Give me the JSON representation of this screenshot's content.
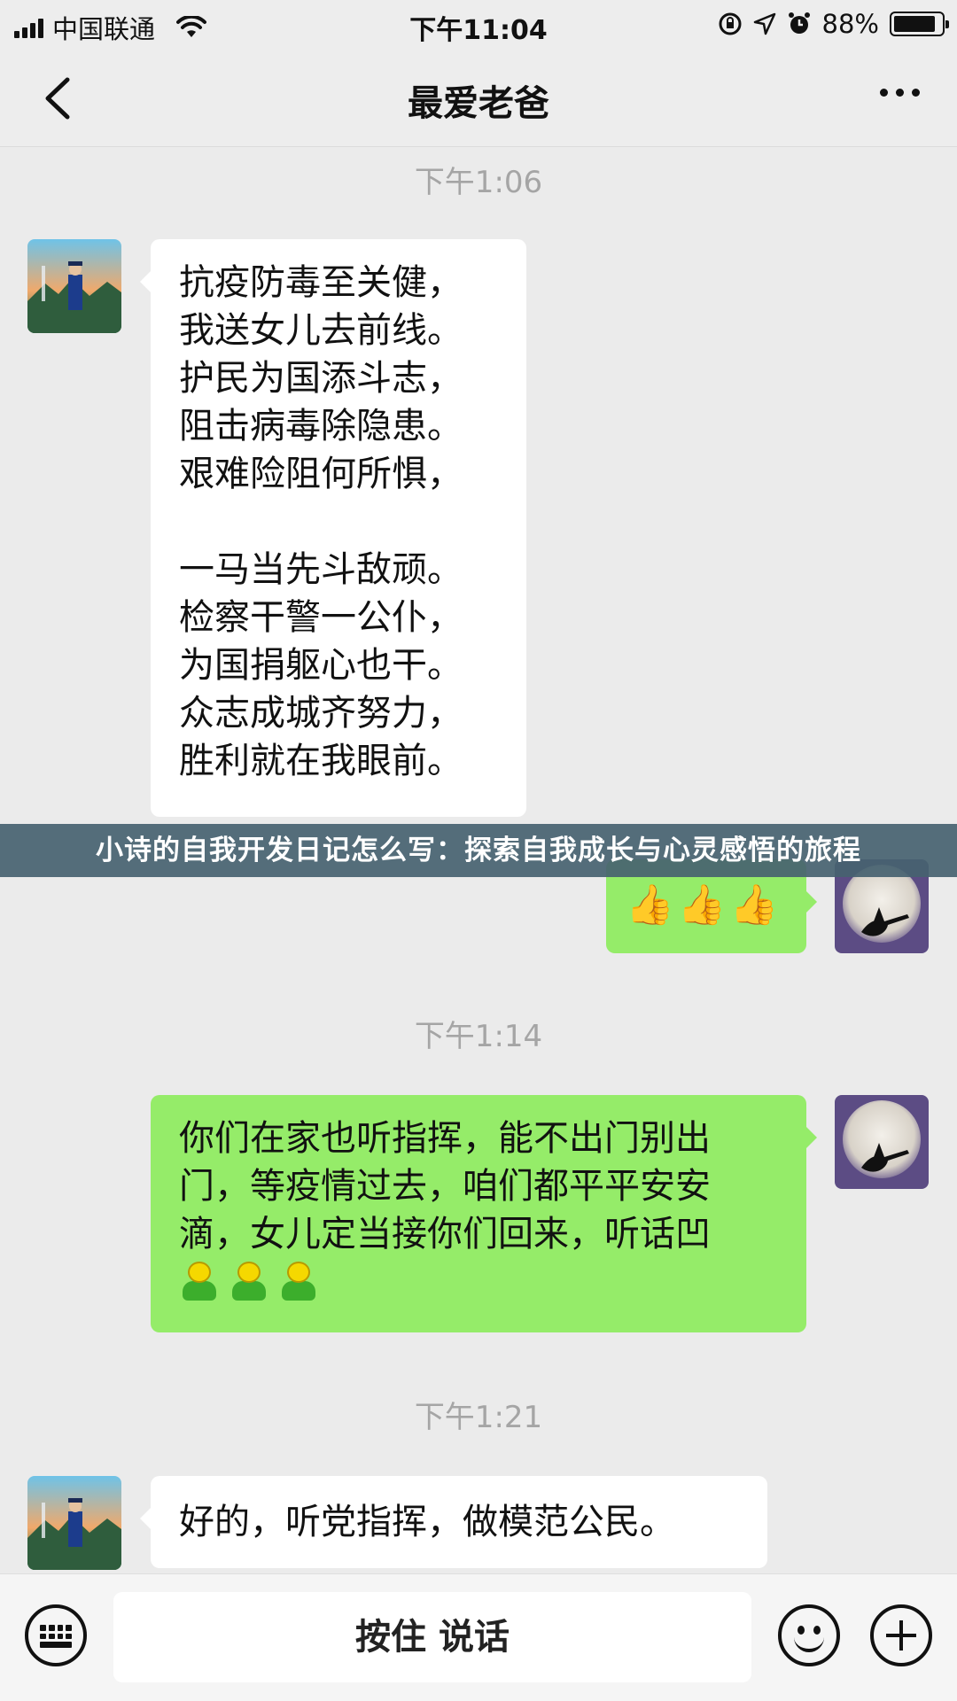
{
  "status_bar": {
    "carrier": "中国联通",
    "time": "下午11:04",
    "battery": "88%",
    "battery_level": 0.88
  },
  "header": {
    "title": "最爱老爸",
    "back_icon": "chevron-left-icon",
    "more_icon": "more-dots-icon"
  },
  "messages": [
    {
      "timestamp": "下午1:06",
      "sender": "dad",
      "lines": [
        "抗疫防毒至关健，",
        "我送女儿去前线。",
        "护民为国添斗志，",
        "阻击病毒除隐患。",
        "艰难险阻何所惧，",
        "",
        "一马当先斗敌顽。",
        "检察干警一公仆，",
        "为国捐躯心也干。",
        "众志成城齐努力，",
        "胜利就在我眼前。"
      ]
    },
    {
      "sender": "daughter",
      "text": "👍👍👍"
    },
    {
      "timestamp": "下午1:14",
      "sender": "daughter",
      "lines": [
        "你们在家也听指挥，能不出门别出",
        "门，等疫情过去，咱们都平平安安",
        "滴，女儿定当接你们回来，听话凹"
      ],
      "emoji": "green-character-icon"
    },
    {
      "timestamp": "下午1:21",
      "sender": "dad",
      "text": "好的，听党指挥，做模范公民。"
    }
  ],
  "overlay_banner": "小诗的自我开发日记怎么写：探索自我成长与心灵感悟的旅程",
  "input_bar": {
    "hold_to_talk": "按住 说话",
    "voice_keyboard_icon": "keyboard-icon",
    "emoji_icon": "smiley-icon",
    "add_icon": "plus-icon"
  },
  "colors": {
    "background": "#ebebeb",
    "incoming_bubble": "#ffffff",
    "outgoing_bubble": "#95ec69",
    "banner": "#466270"
  }
}
